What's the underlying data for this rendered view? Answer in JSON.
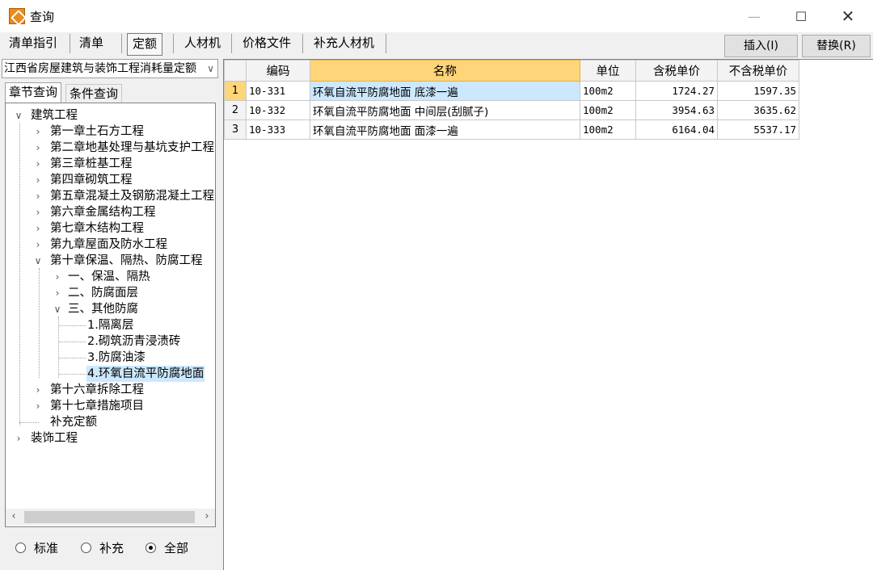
{
  "window": {
    "title": "查询",
    "minimize": "—",
    "maximize": "☐",
    "close": "✕"
  },
  "tabs": [
    {
      "label": "清单指引"
    },
    {
      "label": "清单"
    },
    {
      "label": "定额"
    },
    {
      "label": "人材机"
    },
    {
      "label": "价格文件"
    },
    {
      "label": "补充人材机"
    }
  ],
  "actions": {
    "insert": "插入(I)",
    "replace": "替换(R)"
  },
  "library": {
    "selected": "江西省房屋建筑与装饰工程消耗量定额"
  },
  "subtabs": {
    "chapter": "章节查询",
    "condition": "条件查询"
  },
  "tree": [
    {
      "label": "建筑工程"
    },
    {
      "label": "第一章土石方工程"
    },
    {
      "label": "第二章地基处理与基坑支护工程"
    },
    {
      "label": "第三章桩基工程"
    },
    {
      "label": "第四章砌筑工程"
    },
    {
      "label": "第五章混凝土及钢筋混凝土工程"
    },
    {
      "label": "第六章金属结构工程"
    },
    {
      "label": "第七章木结构工程"
    },
    {
      "label": "第九章屋面及防水工程"
    },
    {
      "label": "第十章保温、隔热、防腐工程"
    },
    {
      "label": "一、保温、隔热"
    },
    {
      "label": "二、防腐面层"
    },
    {
      "label": "三、其他防腐"
    },
    {
      "label": "1.隔离层"
    },
    {
      "label": "2.砌筑沥青浸渍砖"
    },
    {
      "label": "3.防腐油漆"
    },
    {
      "label": "4.环氧自流平防腐地面"
    },
    {
      "label": "第十六章拆除工程"
    },
    {
      "label": "第十七章措施项目"
    },
    {
      "label": "补充定额"
    },
    {
      "label": "装饰工程"
    }
  ],
  "filter": {
    "standard": "标准",
    "supplement": "补充",
    "all": "全部"
  },
  "grid": {
    "headers": {
      "code": "编码",
      "name": "名称",
      "unit": "单位",
      "tax_price": "含税单价",
      "notax_price": "不含税单价"
    },
    "rows": [
      {
        "num": "1",
        "code": "10-331",
        "name": "环氧自流平防腐地面 底漆一遍",
        "unit": "100m2",
        "tax_price": "1724.27",
        "notax_price": "1597.35"
      },
      {
        "num": "2",
        "code": "10-332",
        "name": "环氧自流平防腐地面 中间层(刮腻子)",
        "unit": "100m2",
        "tax_price": "3954.63",
        "notax_price": "3635.62"
      },
      {
        "num": "3",
        "code": "10-333",
        "name": "环氧自流平防腐地面 面漆一遍",
        "unit": "100m2",
        "tax_price": "6164.04",
        "notax_price": "5537.17"
      }
    ]
  },
  "icons": {
    "expanded": "chevron-down-icon",
    "collapsed": "chevron-right-icon"
  },
  "colors": {
    "header_highlight": "#ffd57a",
    "selection": "#cce8ff"
  }
}
